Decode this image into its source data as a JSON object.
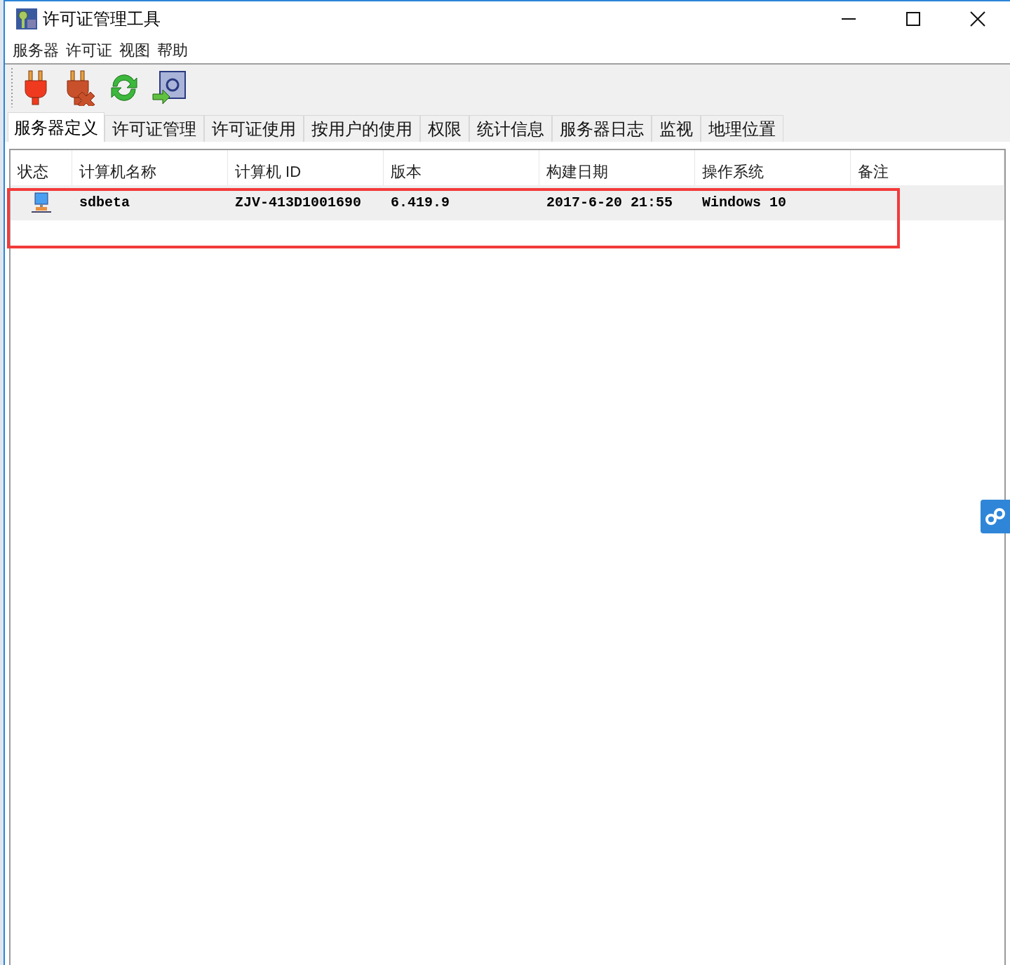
{
  "window": {
    "title": "许可证管理工具"
  },
  "menu": [
    "服务器",
    "许可证",
    "视图",
    "帮助"
  ],
  "tabs": [
    {
      "label": "服务器定义",
      "selected": true
    },
    {
      "label": "许可证管理",
      "selected": false
    },
    {
      "label": "许可证使用",
      "selected": false
    },
    {
      "label": "按用户的使用",
      "selected": false
    },
    {
      "label": "权限",
      "selected": false
    },
    {
      "label": "统计信息",
      "selected": false
    },
    {
      "label": "服务器日志",
      "selected": false
    },
    {
      "label": "监视",
      "selected": false
    },
    {
      "label": "地理位置",
      "selected": false
    }
  ],
  "table": {
    "columns": [
      "状态",
      "计算机名称",
      "计算机 ID",
      "版本",
      "构建日期",
      "操作系统",
      "备注"
    ],
    "rows": [
      {
        "selected": true,
        "cells": [
          "",
          "sdbeta",
          "ZJV-413D1001690",
          "6.419.9",
          "2017-6-20 21:55",
          "Windows 10",
          ""
        ]
      }
    ]
  }
}
